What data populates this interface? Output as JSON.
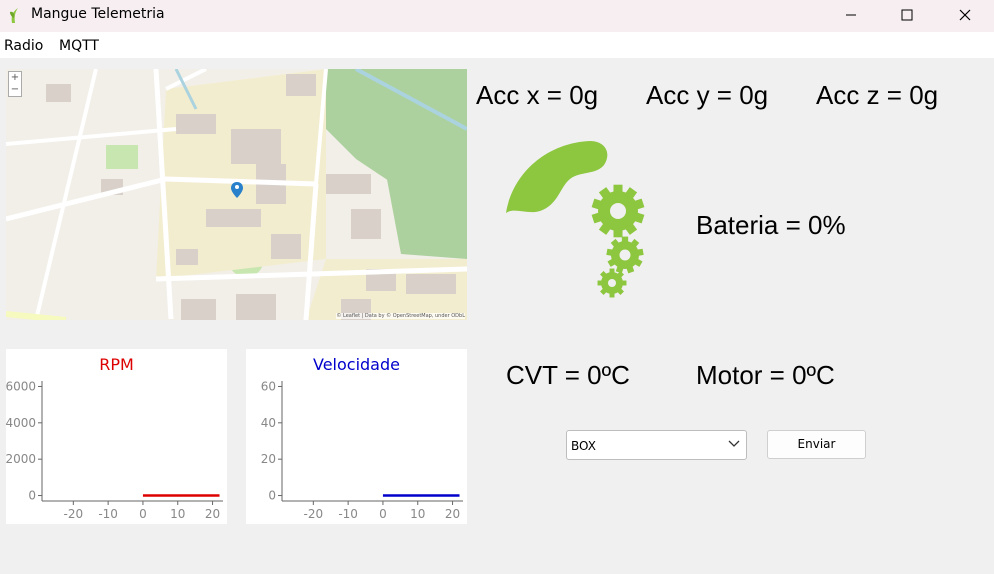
{
  "window": {
    "title": "Mangue Telemetria"
  },
  "menu": {
    "items": [
      "Radio",
      "MQTT"
    ]
  },
  "map": {
    "attribution": "© Leaflet | Data by © OpenStreetMap, under ODbL"
  },
  "readings": {
    "acc_x": "Acc x = 0g",
    "acc_y": "Acc y = 0g",
    "acc_z": "Acc z = 0g",
    "bateria": "Bateria = 0%",
    "cvt": "CVT = 0ºC",
    "motor": "Motor = 0ºC"
  },
  "controls": {
    "select_value": "BOX",
    "send_label": "Enviar"
  },
  "colors": {
    "rpm": "#dd0000",
    "velocidade": "#0000cc",
    "logo": "#8dc63f"
  },
  "chart_data": [
    {
      "type": "line",
      "title": "RPM",
      "xlim": [
        -29,
        23
      ],
      "ylim": [
        -300,
        6300
      ],
      "x_ticks": [
        -20,
        -10,
        0,
        10,
        20
      ],
      "y_ticks": [
        0,
        2000,
        4000,
        6000
      ],
      "series": [
        {
          "x": [
            0,
            22
          ],
          "y": [
            0,
            0
          ]
        }
      ],
      "color": "#dd0000"
    },
    {
      "type": "line",
      "title": "Velocidade",
      "xlim": [
        -29,
        23
      ],
      "ylim": [
        -3,
        63
      ],
      "x_ticks": [
        -20,
        -10,
        0,
        10,
        20
      ],
      "y_ticks": [
        0,
        20,
        40,
        60
      ],
      "series": [
        {
          "x": [
            0,
            22
          ],
          "y": [
            0,
            0
          ]
        }
      ],
      "color": "#0000cc"
    }
  ]
}
